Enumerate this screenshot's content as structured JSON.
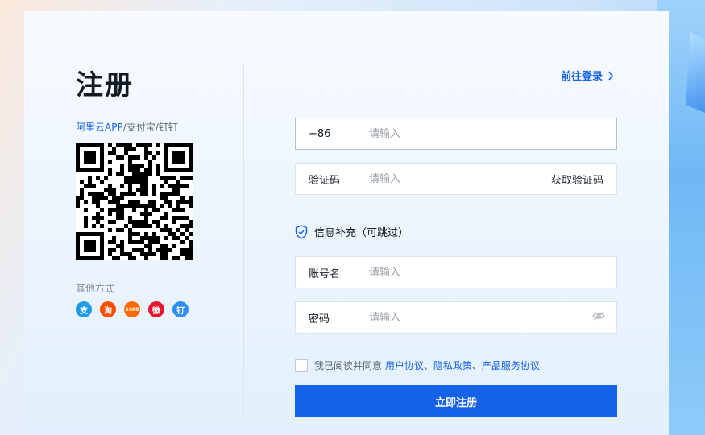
{
  "page": {
    "title": "注册",
    "login_link": "前往登录"
  },
  "scan": {
    "app_highlight": "阿里云APP",
    "app_rest": "/支付宝/钉钉",
    "other_methods": "其他方式",
    "social_icons": [
      {
        "name": "alipay-icon",
        "color": "#1d9be8",
        "glyph": "支"
      },
      {
        "name": "taobao-icon",
        "color": "#ff5000",
        "glyph": "淘"
      },
      {
        "name": "1688-icon",
        "color": "#ff6a00",
        "glyph": "1688"
      },
      {
        "name": "weibo-icon",
        "color": "#e6162d",
        "glyph": "微"
      },
      {
        "name": "dingtalk-icon",
        "color": "#2f8ff5",
        "glyph": "钉"
      }
    ]
  },
  "form": {
    "phone": {
      "prefix": "+86",
      "placeholder": "请输入"
    },
    "code": {
      "label": "验证码",
      "placeholder": "请输入",
      "action": "获取验证码"
    },
    "info_title": "信息补充（可跳过）",
    "account": {
      "label": "账号名",
      "placeholder": "请输入"
    },
    "password": {
      "label": "密码",
      "placeholder": "请输入"
    },
    "agree_text": "我已阅读并同意",
    "user_agreement": "用户协议",
    "sep1": "、",
    "privacy_policy": "隐私政策",
    "sep2": "、",
    "service_agreement": "产品服务协议",
    "submit": "立即注册"
  }
}
